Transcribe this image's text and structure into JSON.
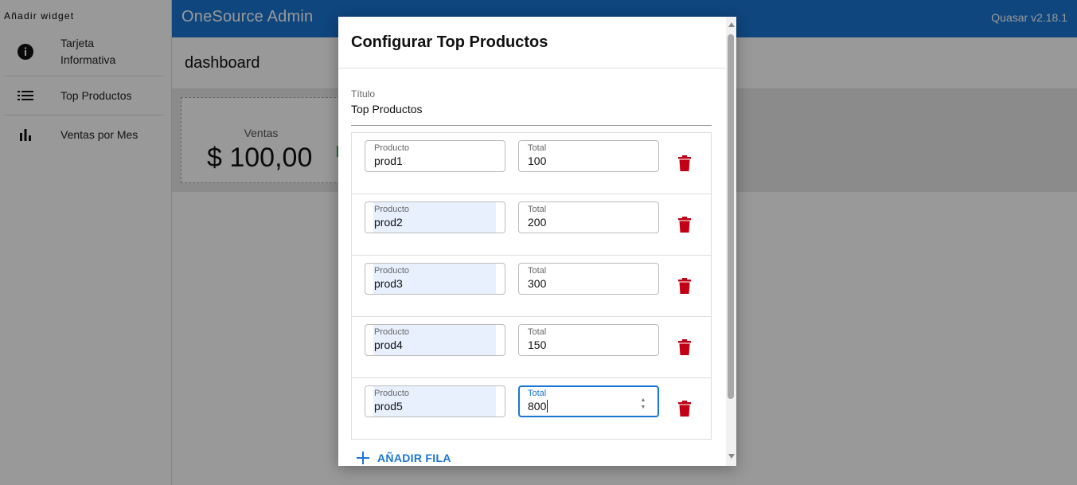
{
  "drawer": {
    "title": "Añadir widget",
    "items": [
      {
        "label": "Tarjeta Informativa",
        "icon": "info-icon"
      },
      {
        "label": "Top Productos",
        "icon": "list-icon"
      },
      {
        "label": "Ventas por Mes",
        "icon": "bar-chart-icon"
      }
    ]
  },
  "header": {
    "app_title": "OneSource Admin",
    "version": "Quasar v2.18.1",
    "color": "#1976d2"
  },
  "page": {
    "title": "dashboard"
  },
  "card": {
    "label": "Ventas",
    "value": "$ 100,00"
  },
  "dialog": {
    "title": "Configurar Top Productos",
    "title_field": {
      "label": "Título",
      "value": "Top Productos"
    },
    "product_label": "Producto",
    "total_label": "Total",
    "rows": [
      {
        "producto": "prod1",
        "total": "100"
      },
      {
        "producto": "prod2",
        "total": "200"
      },
      {
        "producto": "prod3",
        "total": "300"
      },
      {
        "producto": "prod4",
        "total": "150"
      },
      {
        "producto": "prod5",
        "total": "800"
      }
    ],
    "add_row_label": "AÑADIR FILA",
    "delete_color": "#c10015"
  }
}
